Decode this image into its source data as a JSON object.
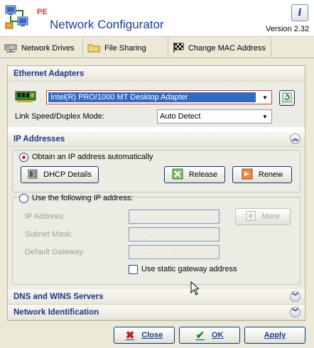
{
  "header": {
    "pe_label": "PE",
    "title": "Network Configurator",
    "version": "Version 2.32"
  },
  "toolbar": {
    "network_drives": "Network Drives",
    "file_sharing": "File Sharing",
    "change_mac": "Change MAC Address"
  },
  "ethernet": {
    "title": "Ethernet Adapters",
    "adapter_value": "Intel(R) PRO/1000 MT Desktop Adapter",
    "link_label": "Link Speed/Duplex Mode:",
    "link_value": "Auto Detect"
  },
  "ip": {
    "title": "IP Addresses",
    "auto_label": "Obtain an IP address automatically",
    "dhcp_details": "DHCP Details",
    "release": "Release",
    "renew": "Renew",
    "manual_label": "Use the following IP address:",
    "ip_address_label": "IP Address:",
    "subnet_label": "Subnet Mask:",
    "gateway_label": "Default Gateway:",
    "more": "More",
    "static_gateway_label": "Use static gateway address",
    "ip_dots": ".",
    "mode": "automatic"
  },
  "sections": {
    "dns_wins": "DNS and WINS Servers",
    "network_id": "Network Identification"
  },
  "buttons": {
    "close": "Close",
    "ok": "OK",
    "apply": "Apply"
  },
  "colors": {
    "title_blue": "#1c3d9c",
    "pe_red": "#d63a2a",
    "selection_blue": "#316ac5"
  }
}
